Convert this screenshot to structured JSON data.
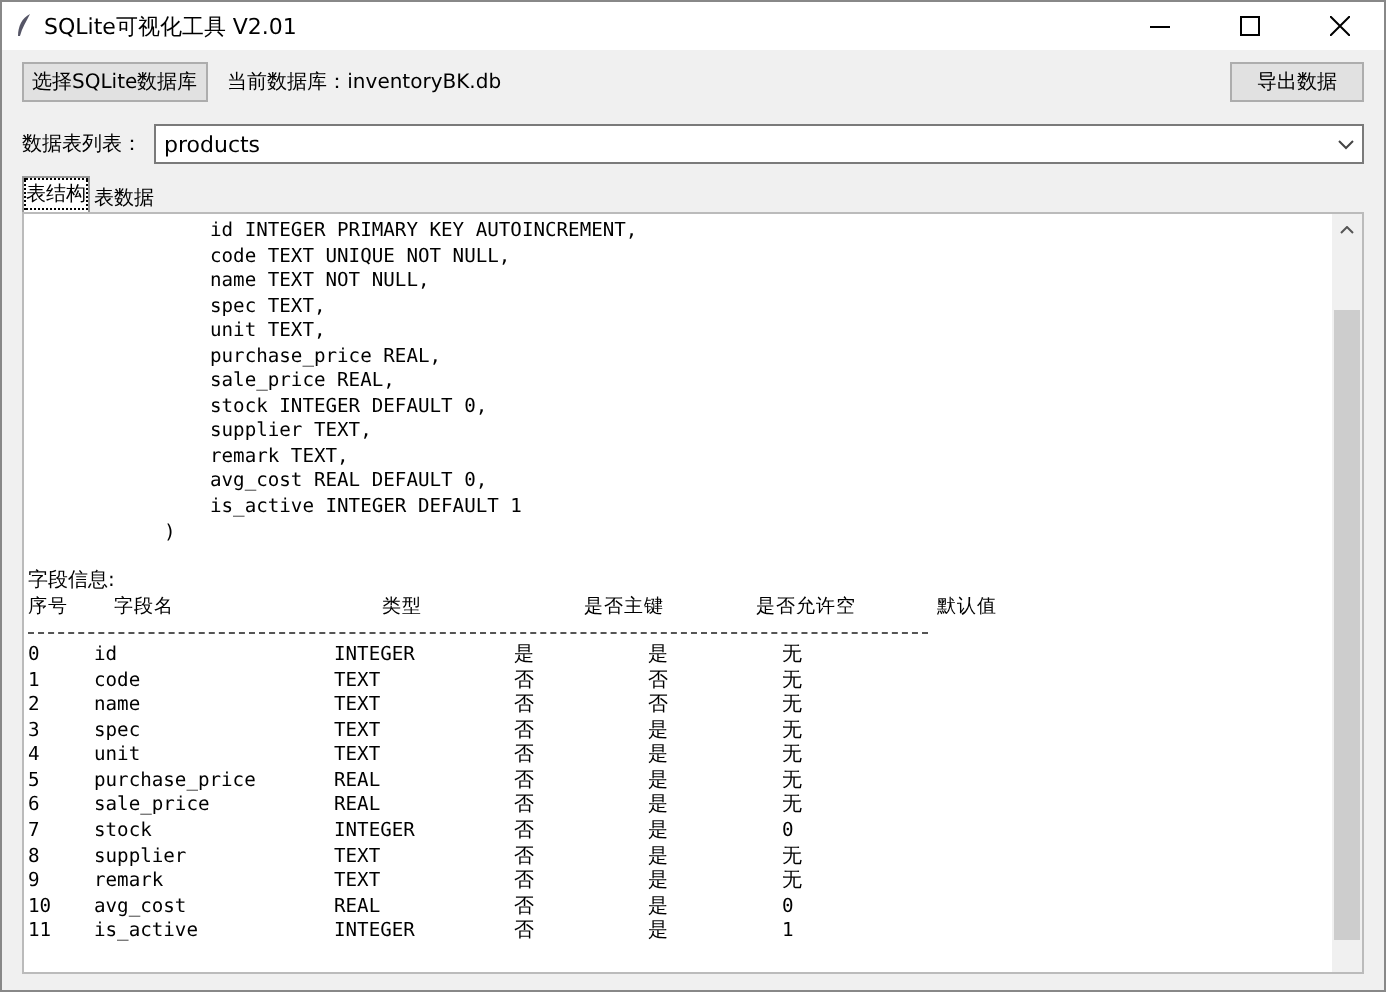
{
  "window": {
    "title": "SQLite可视化工具 V2.01"
  },
  "toolbar": {
    "open_button": "选择SQLite数据库",
    "current_db_label": "当前数据库：inventoryBK.db",
    "export_button": "导出数据"
  },
  "table_selector": {
    "label": "数据表列表：",
    "value": "products"
  },
  "tabs": [
    {
      "label": "表结构",
      "selected": true
    },
    {
      "label": "表数据",
      "selected": false
    }
  ],
  "schema": {
    "columns_sql": [
      "id INTEGER PRIMARY KEY AUTOINCREMENT,",
      "code TEXT UNIQUE NOT NULL,",
      "name TEXT NOT NULL,",
      "spec TEXT,",
      "unit TEXT,",
      "purchase_price REAL,",
      "sale_price REAL,",
      "stock INTEGER DEFAULT 0,",
      "supplier TEXT,",
      "remark TEXT,",
      "avg_cost REAL DEFAULT 0,",
      "is_active INTEGER DEFAULT 1"
    ],
    "closing": ")"
  },
  "field_info": {
    "title": "字段信息:",
    "header_line": "序号    字段名                  类型              是否主键        是否允许空       默认值",
    "rows": [
      [
        "0",
        "id",
        "INTEGER",
        "是",
        "是",
        "无"
      ],
      [
        "1",
        "code",
        "TEXT",
        "否",
        "否",
        "无"
      ],
      [
        "2",
        "name",
        "TEXT",
        "否",
        "否",
        "无"
      ],
      [
        "3",
        "spec",
        "TEXT",
        "否",
        "是",
        "无"
      ],
      [
        "4",
        "unit",
        "TEXT",
        "否",
        "是",
        "无"
      ],
      [
        "5",
        "purchase_price",
        "REAL",
        "否",
        "是",
        "无"
      ],
      [
        "6",
        "sale_price",
        "REAL",
        "否",
        "是",
        "无"
      ],
      [
        "7",
        "stock",
        "INTEGER",
        "否",
        "是",
        "0"
      ],
      [
        "8",
        "supplier",
        "TEXT",
        "否",
        "是",
        "无"
      ],
      [
        "9",
        "remark",
        "TEXT",
        "否",
        "是",
        "无"
      ],
      [
        "10",
        "avg_cost",
        "REAL",
        "否",
        "是",
        "0"
      ],
      [
        "11",
        "is_active",
        "INTEGER",
        "否",
        "是",
        "1"
      ]
    ]
  }
}
